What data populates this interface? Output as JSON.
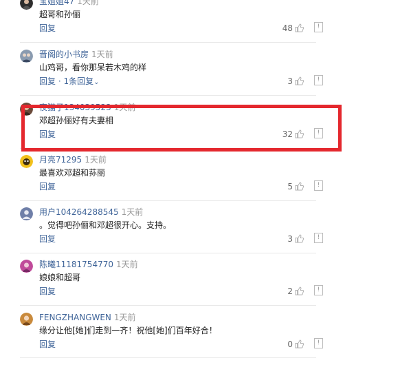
{
  "comments": [
    {
      "username": "宝姐姐47",
      "time": "1天前",
      "content": "超哥和孙俪",
      "reply_label": "回复",
      "replies_text": "",
      "likes": "48",
      "avatar_icon": "avatar-photo-dark",
      "avatar_color": "#2d2d2d"
    },
    {
      "username": "晋阁的小书房",
      "time": "1天前",
      "content": "山鸡哥，看你那呆若木鸡的样",
      "reply_label": "回复",
      "replies_text": "· 1条回复",
      "likes": "3",
      "avatar_icon": "avatar-photo-people",
      "avatar_color": "#8a9bb0"
    },
    {
      "username": "夜猫子134039523",
      "time": "1天前",
      "content": "邓超孙俪好有夫妻相",
      "reply_label": "回复",
      "replies_text": "",
      "likes": "32",
      "avatar_icon": "avatar-photo-person",
      "avatar_color": "#6b4a3a"
    },
    {
      "username": "月亮71295",
      "time": "1天前",
      "content": "最喜欢邓超和荪丽",
      "reply_label": "回复",
      "replies_text": "",
      "likes": "5",
      "avatar_icon": "avatar-cartoon-yellow",
      "avatar_color": "#f2c11c"
    },
    {
      "username": "用户104264288545",
      "time": "1天前",
      "content": "。觉得吧孙俪和邓超很开心。支持。",
      "reply_label": "回复",
      "replies_text": "",
      "likes": "3",
      "avatar_icon": "avatar-default-user",
      "avatar_color": "#6f7fa8"
    },
    {
      "username": "陈曦11181754770",
      "time": "1天前",
      "content": "娘娘和超哥",
      "reply_label": "回复",
      "replies_text": "",
      "likes": "2",
      "avatar_icon": "avatar-photo-pink",
      "avatar_color": "#c04a9a"
    },
    {
      "username": "FENGZHANGWEN",
      "time": "1天前",
      "content": "缘分让他[她]们走到一齐！祝他[她]们百年好合！",
      "reply_label": "回复",
      "replies_text": "",
      "likes": "0",
      "avatar_icon": "avatar-photo-woman",
      "avatar_color": "#c98a3c"
    }
  ],
  "colors": {
    "username": "#406599",
    "highlight_border": "#e4282e"
  }
}
